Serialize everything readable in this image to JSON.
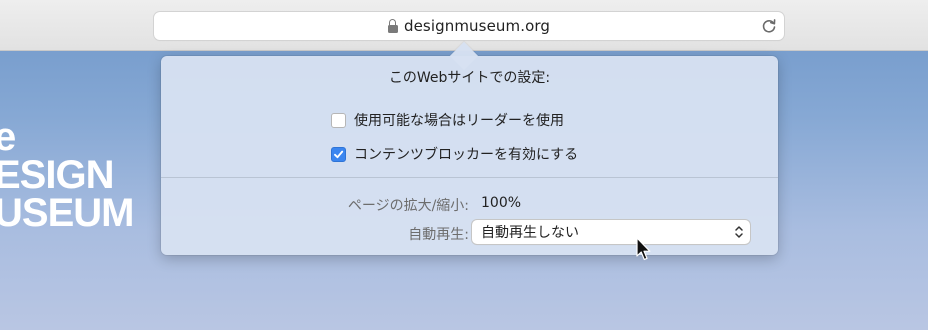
{
  "browser": {
    "url": "designmuseum.org"
  },
  "site": {
    "logo_lines": [
      "e",
      "ESIGN",
      "USEUM"
    ]
  },
  "popover": {
    "title": "このWebサイトでの設定:",
    "options": [
      {
        "label": "使用可能な場合はリーダーを使用",
        "checked": false
      },
      {
        "label": "コンテンツブロッカーを有効にする",
        "checked": true
      }
    ],
    "zoom_label": "ページの拡大/縮小:",
    "zoom_value": "100%",
    "autoplay_label": "自動再生:",
    "autoplay_value": "自動再生しない"
  },
  "colors": {
    "accent": "#3b86f0"
  }
}
